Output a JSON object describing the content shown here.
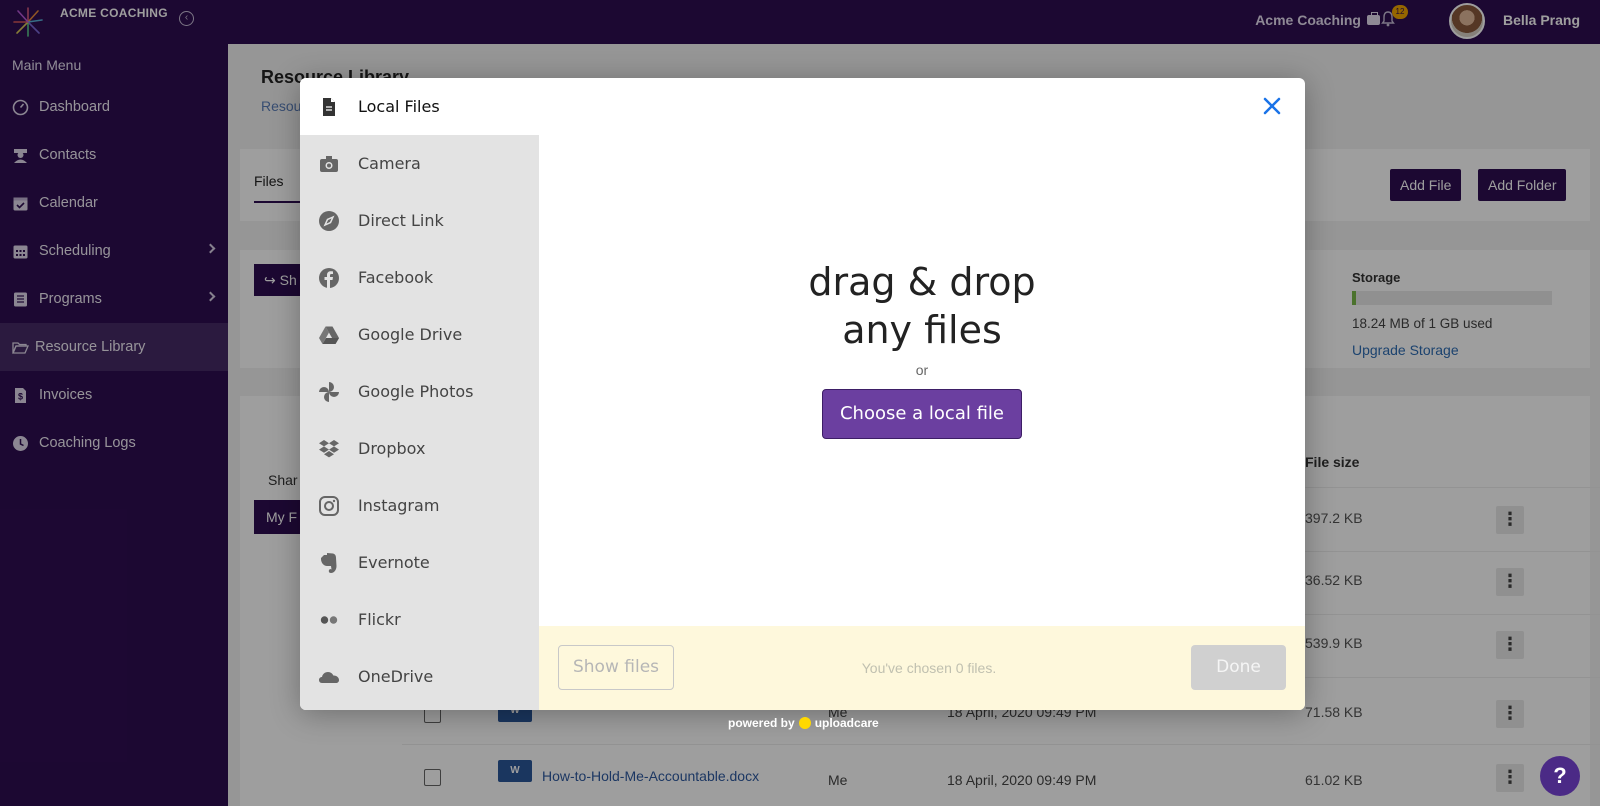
{
  "topbar": {
    "brand": "ACME COACHING",
    "org": "Acme Coaching",
    "notifications": "12",
    "user": "Bella Prang"
  },
  "sidebar": {
    "title": "Main Menu",
    "items": [
      {
        "label": "Dashboard",
        "icon": "gauge-icon"
      },
      {
        "label": "Contacts",
        "icon": "contacts-icon"
      },
      {
        "label": "Calendar",
        "icon": "calendar-check-icon"
      },
      {
        "label": "Scheduling",
        "icon": "calendar-grid-icon"
      },
      {
        "label": "Programs",
        "icon": "book-icon"
      },
      {
        "label": "Resource Library",
        "icon": "folder-open-icon"
      },
      {
        "label": "Invoices",
        "icon": "invoice-icon"
      },
      {
        "label": "Coaching Logs",
        "icon": "clock-icon"
      }
    ]
  },
  "main": {
    "title": "Resource Library",
    "crumb": "Resou",
    "tab_files": "Files",
    "add_file": "Add File",
    "add_folder": "Add Folder",
    "share_btn": "Sh",
    "storage_label": "Storage",
    "storage_fraction": 0.018,
    "storage_used": "18.24 MB of 1 GB used",
    "upgrade": "Upgrade Storage",
    "shared_tab": "Shar",
    "my_files_btn": "My F",
    "col_size": "File size",
    "rows": [
      {
        "size": "397.2 KB"
      },
      {
        "size": "36.52 KB"
      },
      {
        "size": "539.9 KB"
      },
      {
        "owner": "Me",
        "date": "18 April, 2020 09:49 PM",
        "size": "71.58 KB"
      },
      {
        "name": "How-to-Hold-Me-Accountable.docx",
        "owner": "Me",
        "date": "18 April, 2020 09:49 PM",
        "size": "61.02 KB"
      }
    ]
  },
  "modal": {
    "sources": [
      {
        "label": "Local Files",
        "icon": "file-icon"
      },
      {
        "label": "Camera",
        "icon": "camera-icon"
      },
      {
        "label": "Direct Link",
        "icon": "compass-icon"
      },
      {
        "label": "Facebook",
        "icon": "facebook-icon"
      },
      {
        "label": "Google Drive",
        "icon": "google-drive-icon"
      },
      {
        "label": "Google Photos",
        "icon": "google-photos-icon"
      },
      {
        "label": "Dropbox",
        "icon": "dropbox-icon"
      },
      {
        "label": "Instagram",
        "icon": "instagram-icon"
      },
      {
        "label": "Evernote",
        "icon": "evernote-icon"
      },
      {
        "label": "Flickr",
        "icon": "flickr-icon"
      },
      {
        "label": "OneDrive",
        "icon": "onedrive-icon"
      }
    ],
    "drop_line1": "drag & drop",
    "drop_line2": "any files",
    "or": "or",
    "choose": "Choose a local file",
    "show_files": "Show files",
    "chosen": "You've chosen 0 files.",
    "done": "Done",
    "powered_by": "powered by",
    "powered_brand": "uploadcare"
  },
  "help": "?",
  "colors": {
    "brand": "#2e0d52",
    "accent": "#6b3fa0",
    "close": "#1a73e8"
  }
}
